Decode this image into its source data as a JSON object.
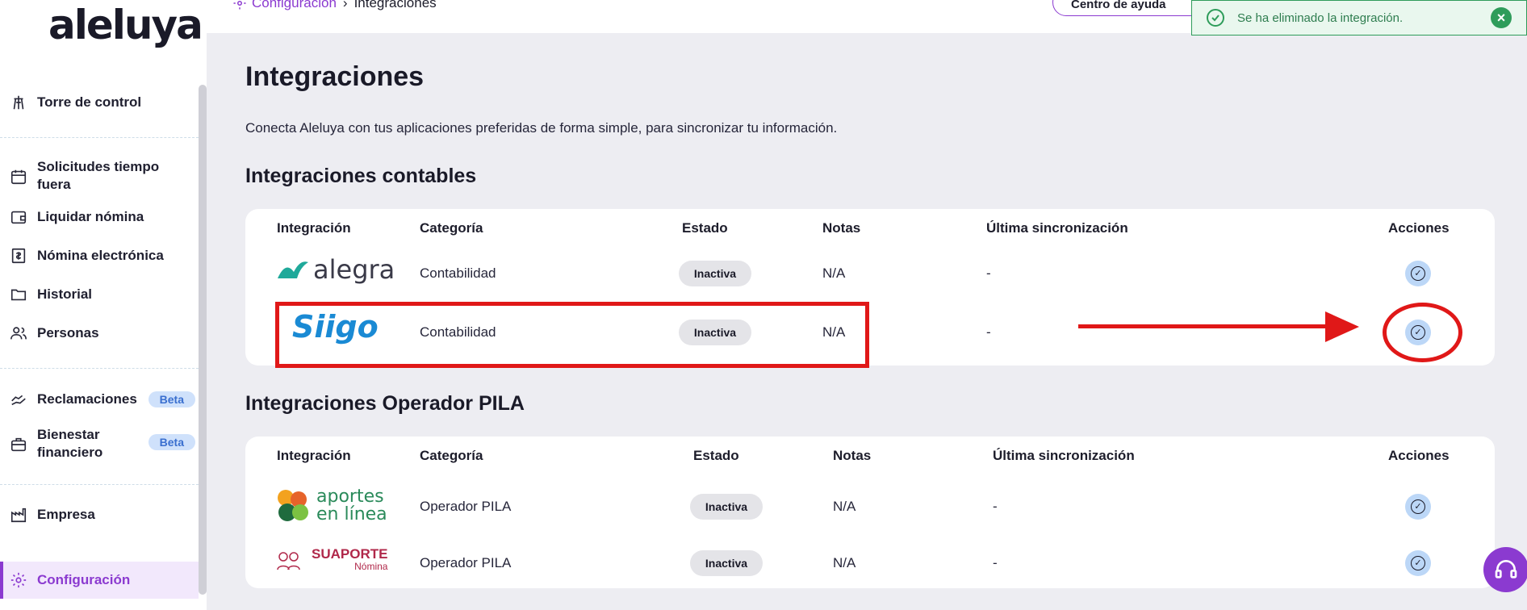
{
  "app": {
    "logo_text": "aleluya"
  },
  "sidebar": {
    "items": [
      {
        "label": "Torre de control",
        "icon": "tower-icon"
      },
      {
        "label": "Solicitudes tiempo fuera",
        "icon": "calendar-icon"
      },
      {
        "label": "Liquidar nómina",
        "icon": "wallet-icon"
      },
      {
        "label": "Nómina electrónica",
        "icon": "dollar-doc-icon"
      },
      {
        "label": "Historial",
        "icon": "folder-icon"
      },
      {
        "label": "Personas",
        "icon": "people-icon"
      },
      {
        "label": "Reclamaciones",
        "icon": "hand-icon",
        "badge": "Beta"
      },
      {
        "label": "Bienestar financiero",
        "icon": "briefcase-icon",
        "badge": "Beta"
      },
      {
        "label": "Empresa",
        "icon": "factory-icon"
      },
      {
        "label": "Configuración",
        "icon": "gear-icon",
        "active": true
      }
    ]
  },
  "topbar": {
    "breadcrumb": [
      "Configuración",
      "Integraciones"
    ],
    "help_label": "Centro de ayuda"
  },
  "toast": {
    "message": "Se ha eliminado la integración.",
    "close": "×"
  },
  "page": {
    "title": "Integraciones",
    "subtitle": "Conecta Aleluya con tus aplicaciones preferidas de forma simple, para sincronizar tu información."
  },
  "sections": [
    {
      "title": "Integraciones contables",
      "columns": [
        "Integración",
        "Categoría",
        "Estado",
        "Notas",
        "Última sincronización",
        "Acciones"
      ],
      "rows": [
        {
          "logo": "alegra",
          "category": "Contabilidad",
          "status": "Inactiva",
          "notes": "N/A",
          "last_sync": "-"
        },
        {
          "logo": "Siigo",
          "category": "Contabilidad",
          "status": "Inactiva",
          "notes": "N/A",
          "last_sync": "-"
        }
      ]
    },
    {
      "title": "Integraciones Operador PILA",
      "columns": [
        "Integración",
        "Categoría",
        "Estado",
        "Notas",
        "Última sincronización",
        "Acciones"
      ],
      "rows": [
        {
          "logo": "aportes en línea",
          "category": "Operador PILA",
          "status": "Inactiva",
          "notes": "N/A",
          "last_sync": "-"
        },
        {
          "logo": "SUAPORTE Nómina",
          "category": "Operador PILA",
          "status": "Inactiva",
          "notes": "N/A",
          "last_sync": "-"
        }
      ]
    }
  ],
  "logos": {
    "alegra": "alegra",
    "siigo": "Siigo",
    "aportes_line1": "aportes",
    "aportes_line2": "en línea",
    "sua_title": "SUAPORTE",
    "sua_sub": "Nómina"
  },
  "colors": {
    "accent": "#8b3ad0",
    "annotation": "#e01818",
    "toast_green": "#2e9c5a"
  }
}
